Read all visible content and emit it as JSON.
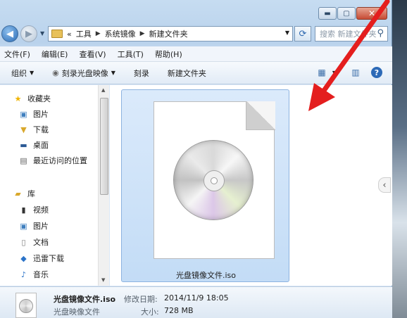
{
  "window": {
    "caption": {
      "minimize": "▬",
      "maximize": "▢",
      "close": "✕"
    }
  },
  "address": {
    "overflow": "«",
    "crumbs": [
      "工具",
      "系统镜像",
      "新建文件夹"
    ],
    "search_placeholder": "搜索 新建文件夹"
  },
  "menu": [
    "文件(F)",
    "编辑(E)",
    "查看(V)",
    "工具(T)",
    "帮助(H)"
  ],
  "toolbar": {
    "organize": "组织",
    "burn_image": "刻录光盘映像",
    "burn": "刻录",
    "new_folder": "新建文件夹",
    "help": "?"
  },
  "sidebar": {
    "favorites": "收藏夹",
    "fav_items": [
      "图片",
      "下载",
      "桌面",
      "最近访问的位置"
    ],
    "libraries": "库",
    "lib_items": [
      "视频",
      "图片",
      "文档",
      "迅雷下载",
      "音乐"
    ]
  },
  "content": {
    "file_name": "光盘镜像文件.iso"
  },
  "details": {
    "name": "光盘镜像文件.iso",
    "type": "光盘映像文件",
    "modified_label": "修改日期:",
    "modified_value": "2014/11/9 18:05",
    "size_label": "大小:",
    "size_value": "728 MB"
  },
  "colors": {
    "accent": "#3a78c4",
    "selection": "#cce0f8",
    "annotation": "#e41e1e"
  }
}
